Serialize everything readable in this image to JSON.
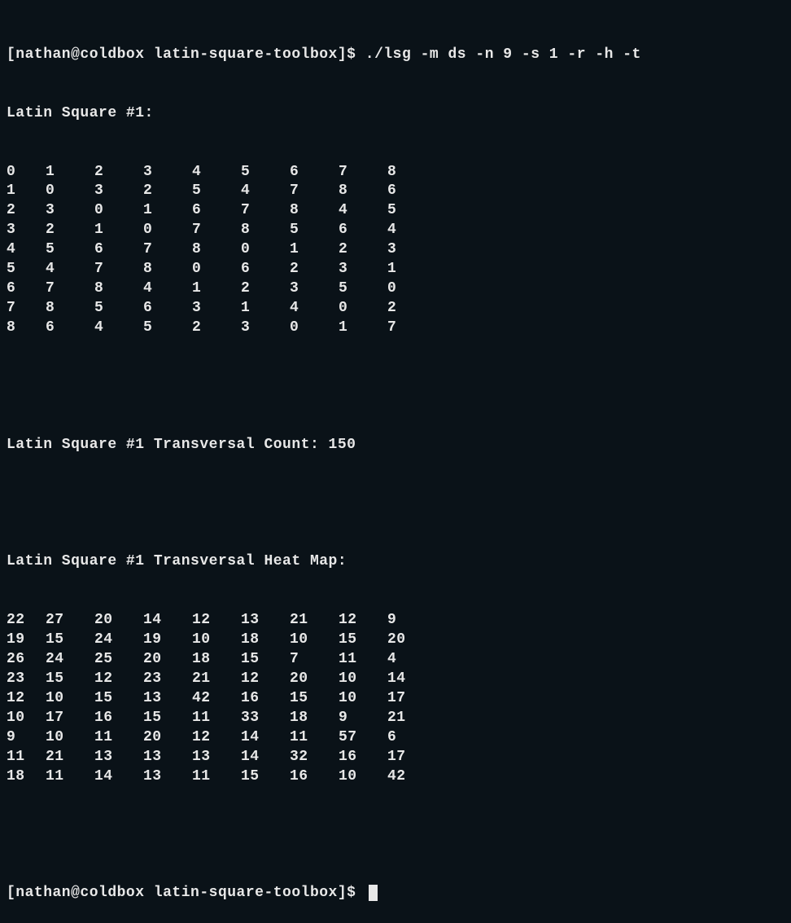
{
  "prompt1": "[nathan@coldbox latin-square-toolbox]$ ./lsg -m ds -n 9 -s 1 -r -h -t",
  "header_square": "Latin Square #1:",
  "square_rows": [
    [
      "0",
      "1",
      "2",
      "3",
      "4",
      "5",
      "6",
      "7",
      "8"
    ],
    [
      "1",
      "0",
      "3",
      "2",
      "5",
      "4",
      "7",
      "8",
      "6"
    ],
    [
      "2",
      "3",
      "0",
      "1",
      "6",
      "7",
      "8",
      "4",
      "5"
    ],
    [
      "3",
      "2",
      "1",
      "0",
      "7",
      "8",
      "5",
      "6",
      "4"
    ],
    [
      "4",
      "5",
      "6",
      "7",
      "8",
      "0",
      "1",
      "2",
      "3"
    ],
    [
      "5",
      "4",
      "7",
      "8",
      "0",
      "6",
      "2",
      "3",
      "1"
    ],
    [
      "6",
      "7",
      "8",
      "4",
      "1",
      "2",
      "3",
      "5",
      "0"
    ],
    [
      "7",
      "8",
      "5",
      "6",
      "3",
      "1",
      "4",
      "0",
      "2"
    ],
    [
      "8",
      "6",
      "4",
      "5",
      "2",
      "3",
      "0",
      "1",
      "7"
    ]
  ],
  "transversal_count_line": "Latin Square #1 Transversal Count: 150",
  "heatmap_header": "Latin Square #1 Transversal Heat Map:",
  "heatmap_rows": [
    [
      "22",
      "27",
      "20",
      "14",
      "12",
      "13",
      "21",
      "12",
      "9"
    ],
    [
      "19",
      "15",
      "24",
      "19",
      "10",
      "18",
      "10",
      "15",
      "20"
    ],
    [
      "26",
      "24",
      "25",
      "20",
      "18",
      "15",
      "7",
      "11",
      "4"
    ],
    [
      "23",
      "15",
      "12",
      "23",
      "21",
      "12",
      "20",
      "10",
      "14"
    ],
    [
      "12",
      "10",
      "15",
      "13",
      "42",
      "16",
      "15",
      "10",
      "17"
    ],
    [
      "10",
      "17",
      "16",
      "15",
      "11",
      "33",
      "18",
      "9",
      "21"
    ],
    [
      "9",
      "10",
      "11",
      "20",
      "12",
      "14",
      "11",
      "57",
      "6"
    ],
    [
      "11",
      "21",
      "13",
      "13",
      "13",
      "14",
      "32",
      "16",
      "17"
    ],
    [
      "18",
      "11",
      "14",
      "13",
      "11",
      "15",
      "16",
      "10",
      "42"
    ]
  ],
  "prompt2": "[nathan@coldbox latin-square-toolbox]$ "
}
